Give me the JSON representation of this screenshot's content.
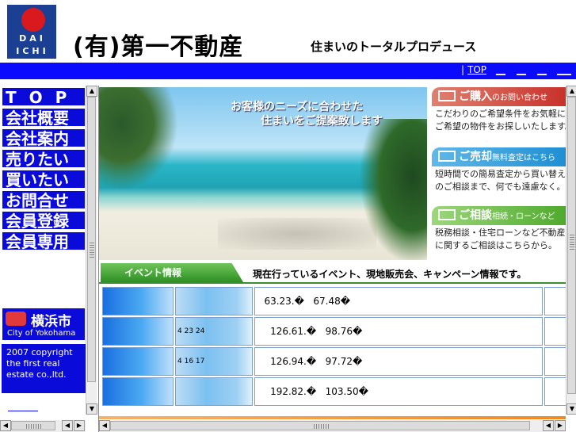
{
  "header": {
    "logo_line1": "DAI",
    "logo_line2": "ICHI",
    "company": "(有)第一不動産",
    "tagline": "住まいのトータルプロデュース"
  },
  "navbar": {
    "separator": "|",
    "top_link": "TOP",
    "blank_links": [
      "__",
      "__",
      "__",
      "___"
    ]
  },
  "sidebar": {
    "menu": [
      {
        "label": "TOP"
      },
      {
        "label": "会社概要"
      },
      {
        "label": "会社案内"
      },
      {
        "label": "売りたい"
      },
      {
        "label": "買いたい"
      },
      {
        "label": "お問合せ"
      },
      {
        "label": "会員登録"
      },
      {
        "label": "会員専用"
      }
    ],
    "banner_title": "横浜市",
    "banner_subtitle": "City of Yokohama",
    "copyright": "2007 copyright the first real estate co.,ltd."
  },
  "hero": {
    "caption_line1": "お客様のニーズに合わせた",
    "caption_line2": "住まいをご提案致します"
  },
  "side_boxes": [
    {
      "title": "ご購入",
      "sub": "のお問い合わせ",
      "line1": "こだわりのご希望条件をお気軽に",
      "line2": "ご希望の物件をお探しいたします。"
    },
    {
      "title": "ご売却",
      "sub": "無料査定はこちら",
      "line1": "短時間での簡易査定から買い替え",
      "line2": "のご相談まで、何でも遠慮なく。"
    },
    {
      "title": "ご相談",
      "sub": "相続・ローンなど",
      "line1": "税務相談・住宅ローンなど不動産",
      "line2": "に関するご相談はこちらから。"
    }
  ],
  "events": {
    "tab_label": "イベント情報",
    "headline": "現在行っているイベント、現地販売会、キャンペーン情報です。",
    "rows": [
      {
        "col2": "",
        "col3": "   63.23.�   67.48�"
      },
      {
        "col2": "4 23    24",
        "col3": "     126.61.�   98.76�"
      },
      {
        "col2": "4 16    17",
        "col3": "     126.94.�   97.72�"
      },
      {
        "col2": "",
        "col3": "     192.82.�   103.50�"
      }
    ]
  },
  "scroll": {
    "up": "▲",
    "down": "▼",
    "left": "◀",
    "right": "▶"
  },
  "colors": {
    "nav_blue": "#0a0aff",
    "menu_blue": "#0b0bd9",
    "event_green": "#3a8f2c"
  }
}
